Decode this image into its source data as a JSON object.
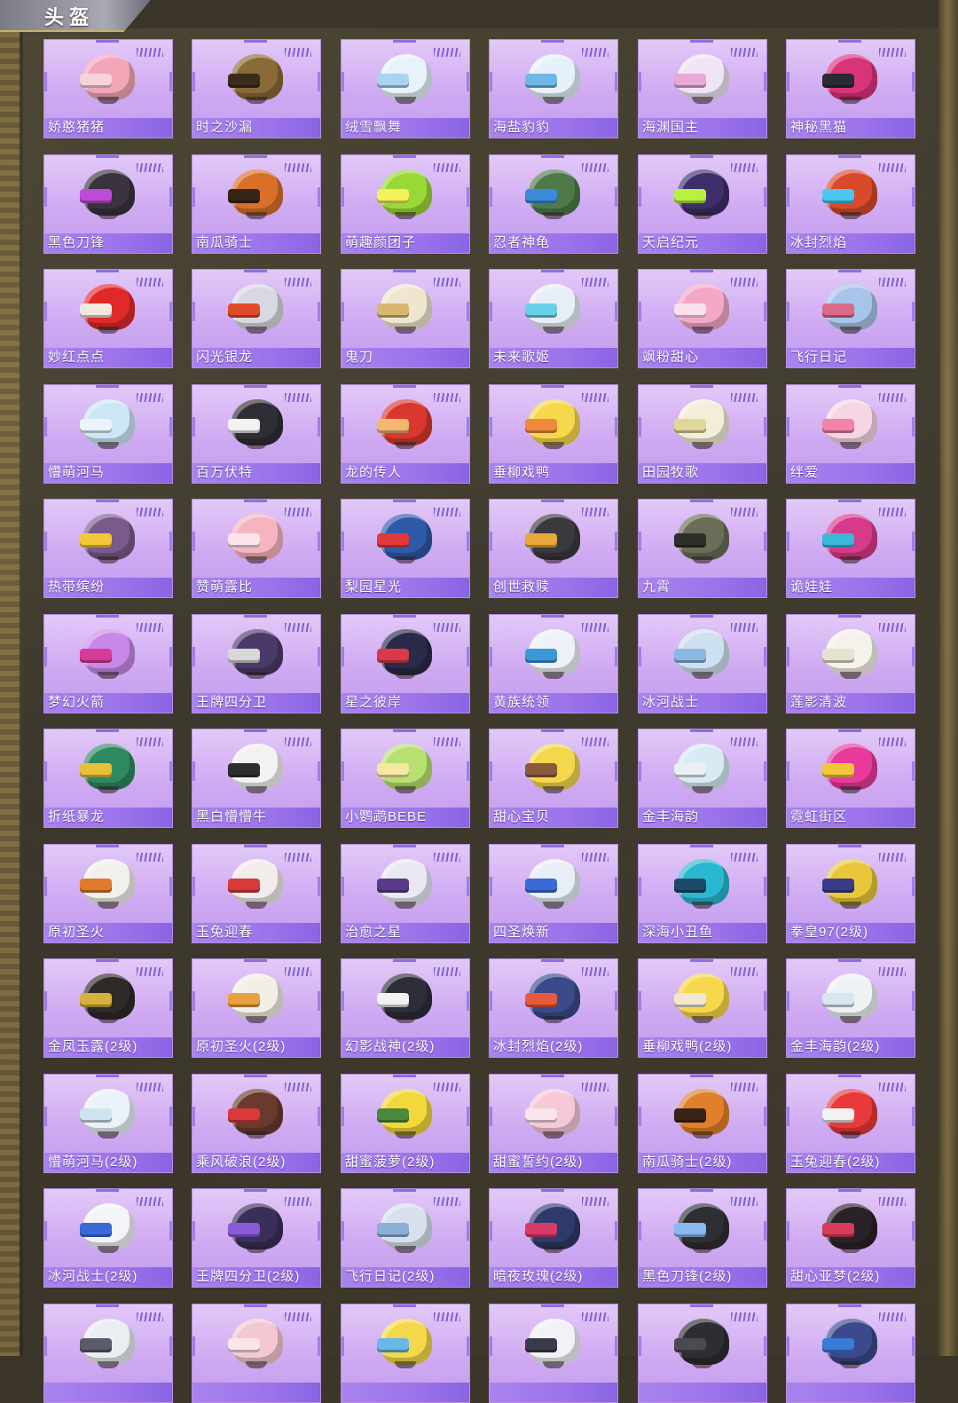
{
  "header": {
    "title": "头盔"
  },
  "helmets": [
    {
      "name": "娇憨猪猪",
      "color": "#f2a6b8",
      "visor": "#f7d4dc"
    },
    {
      "name": "时之沙漏",
      "color": "#8a6a36",
      "visor": "#3a2c1a"
    },
    {
      "name": "绒雪飘舞",
      "color": "#e8f2fb",
      "visor": "#a9d4f0"
    },
    {
      "name": "海盐豹豹",
      "color": "#e6f1fa",
      "visor": "#6fb9e8"
    },
    {
      "name": "海渊国主",
      "color": "#efe4f4",
      "visor": "#e8a8d8"
    },
    {
      "name": "神秘黑猫",
      "color": "#d8347a",
      "visor": "#2a2a32"
    },
    {
      "name": "黑色刀锋",
      "color": "#3a3340",
      "visor": "#c04ad8"
    },
    {
      "name": "南瓜骑士",
      "color": "#d8702a",
      "visor": "#3a2418"
    },
    {
      "name": "萌趣颜团子",
      "color": "#9ad838",
      "visor": "#f2f25a"
    },
    {
      "name": "忍者神龟",
      "color": "#4e7a4a",
      "visor": "#3a8ad8"
    },
    {
      "name": "天启纪元",
      "color": "#3e2e6a",
      "visor": "#b8f040"
    },
    {
      "name": "冰封烈焰",
      "color": "#d84a2a",
      "visor": "#4ac8f0"
    },
    {
      "name": "妙红点点",
      "color": "#e02a2a",
      "visor": "#f2e8e0"
    },
    {
      "name": "闪光银龙",
      "color": "#d8d8e0",
      "visor": "#e04a2a"
    },
    {
      "name": "鬼刀",
      "color": "#efe6d0",
      "visor": "#d8b870"
    },
    {
      "name": "未来歌姬",
      "color": "#e8eef6",
      "visor": "#6ad0e8"
    },
    {
      "name": "飒粉甜心",
      "color": "#f4a8c8",
      "visor": "#fce0ec"
    },
    {
      "name": "飞行日记",
      "color": "#a8c4e8",
      "visor": "#d86a8a"
    },
    {
      "name": "懵萌河马",
      "color": "#cce6f6",
      "visor": "#eaf4fa"
    },
    {
      "name": "百万伏特",
      "color": "#2e2e34",
      "visor": "#f2f2f2"
    },
    {
      "name": "龙的传人",
      "color": "#d8382e",
      "visor": "#f2b870"
    },
    {
      "name": "垂柳戏鸭",
      "color": "#f6d84a",
      "visor": "#f08a3a"
    },
    {
      "name": "田园牧歌",
      "color": "#f2eed8",
      "visor": "#e0d89a"
    },
    {
      "name": "绊爱",
      "color": "#f6d6e4",
      "visor": "#f282a8"
    },
    {
      "name": "热带缤纷",
      "color": "#7a5a8a",
      "visor": "#f2c83a"
    },
    {
      "name": "赞萌露比",
      "color": "#f6b4c0",
      "visor": "#fce4e8"
    },
    {
      "name": "梨园星光",
      "color": "#2e5aa8",
      "visor": "#e03a3a"
    },
    {
      "name": "创世救赎",
      "color": "#3a3a3e",
      "visor": "#e8a83a"
    },
    {
      "name": "九霄",
      "color": "#6a6e58",
      "visor": "#2e2e2a"
    },
    {
      "name": "诡娃娃",
      "color": "#d83a8a",
      "visor": "#3ab8d8"
    },
    {
      "name": "梦幻火箭",
      "color": "#c888e8",
      "visor": "#d83a9a"
    },
    {
      "name": "王牌四分卫",
      "color": "#4a3a6a",
      "visor": "#d8d8d8"
    },
    {
      "name": "星之彼岸",
      "color": "#2a2a4a",
      "visor": "#d83a4a"
    },
    {
      "name": "黄族统领",
      "color": "#eef2f6",
      "visor": "#3a9ad8"
    },
    {
      "name": "冰河战士",
      "color": "#cfe0f0",
      "visor": "#8ab8e0"
    },
    {
      "name": "莲影清波",
      "color": "#f4f2ea",
      "visor": "#e6e2d0"
    },
    {
      "name": "折纸暴龙",
      "color": "#2e8a5e",
      "visor": "#e8c03a"
    },
    {
      "name": "黑白懵懵牛",
      "color": "#f2f2f2",
      "visor": "#2e2e2e"
    },
    {
      "name": "小鹦鹉BEBE",
      "color": "#b8e070",
      "visor": "#f6e8a0"
    },
    {
      "name": "甜心宝贝",
      "color": "#f2d84a",
      "visor": "#8a5a3a"
    },
    {
      "name": "金丰海韵",
      "color": "#d8eaf4",
      "visor": "#eaf0f4"
    },
    {
      "name": "霓虹街区",
      "color": "#e83a9a",
      "visor": "#f2c83a"
    },
    {
      "name": "原初圣火",
      "color": "#f2f0ea",
      "visor": "#e07a2a"
    },
    {
      "name": "玉兔迎春",
      "color": "#f2ecec",
      "visor": "#d83a3a"
    },
    {
      "name": "治愈之星",
      "color": "#e8e8f2",
      "visor": "#5a3a8a"
    },
    {
      "name": "四圣焕新",
      "color": "#e8eef6",
      "visor": "#3a6ad8"
    },
    {
      "name": "深海小丑鱼",
      "color": "#2ab8d0",
      "visor": "#1a4a6a"
    },
    {
      "name": "拳皇97(2级)",
      "color": "#e8c83a",
      "visor": "#3a3a8a"
    },
    {
      "name": "金凤玉露(2级)",
      "color": "#2e2a28",
      "visor": "#d8b040"
    },
    {
      "name": "原初圣火(2级)",
      "color": "#f2efe6",
      "visor": "#e8a040"
    },
    {
      "name": "幻影战神(2级)",
      "color": "#2e2e3a",
      "visor": "#f2f2f2"
    },
    {
      "name": "冰封烈焰(2级)",
      "color": "#3a4a8a",
      "visor": "#e85a3a"
    },
    {
      "name": "垂柳戏鸭(2级)",
      "color": "#f6d84a",
      "visor": "#f2e8d0"
    },
    {
      "name": "金丰海韵(2级)",
      "color": "#eef2f4",
      "visor": "#d8e6f0"
    },
    {
      "name": "懵萌河马(2级)",
      "color": "#eaf2f8",
      "visor": "#d0e4f0"
    },
    {
      "name": "乘风破浪(2级)",
      "color": "#6a3a2e",
      "visor": "#d83a3a"
    },
    {
      "name": "甜蜜菠萝(2级)",
      "color": "#f2d83a",
      "visor": "#4a8a3a"
    },
    {
      "name": "甜蜜誓约(2级)",
      "color": "#f6c8d8",
      "visor": "#fbe4ec"
    },
    {
      "name": "南瓜骑士(2级)",
      "color": "#e0802a",
      "visor": "#3a2418"
    },
    {
      "name": "玉兔迎春(2级)",
      "color": "#e83a3a",
      "visor": "#f2f2f2"
    },
    {
      "name": "冰河战士(2级)",
      "color": "#f2f4f8",
      "visor": "#3a6ad8"
    },
    {
      "name": "王牌四分卫(2级)",
      "color": "#3a2e5a",
      "visor": "#8a5ad8"
    },
    {
      "name": "飞行日记(2级)",
      "color": "#d8e0ee",
      "visor": "#8ab0d8"
    },
    {
      "name": "暗夜玫瑰(2级)",
      "color": "#2e3a6a",
      "visor": "#d83a6a"
    },
    {
      "name": "黑色刀锋(2级)",
      "color": "#2e2e34",
      "visor": "#8ab8f0"
    },
    {
      "name": "甜心亚梦(2级)",
      "color": "#2a2228",
      "visor": "#d83a5a"
    },
    {
      "name": "",
      "color": "#e8eef2",
      "visor": "#5a5a6a"
    },
    {
      "name": "",
      "color": "#f4c8d0",
      "visor": "#fbe4ea"
    },
    {
      "name": "",
      "color": "#f2d84a",
      "visor": "#6ab8e8"
    },
    {
      "name": "",
      "color": "#f2f2f6",
      "visor": "#3a3a4a"
    },
    {
      "name": "",
      "color": "#2e2e32",
      "visor": "#4a4a52"
    },
    {
      "name": "",
      "color": "#3a4a8a",
      "visor": "#3a7ad8"
    }
  ]
}
